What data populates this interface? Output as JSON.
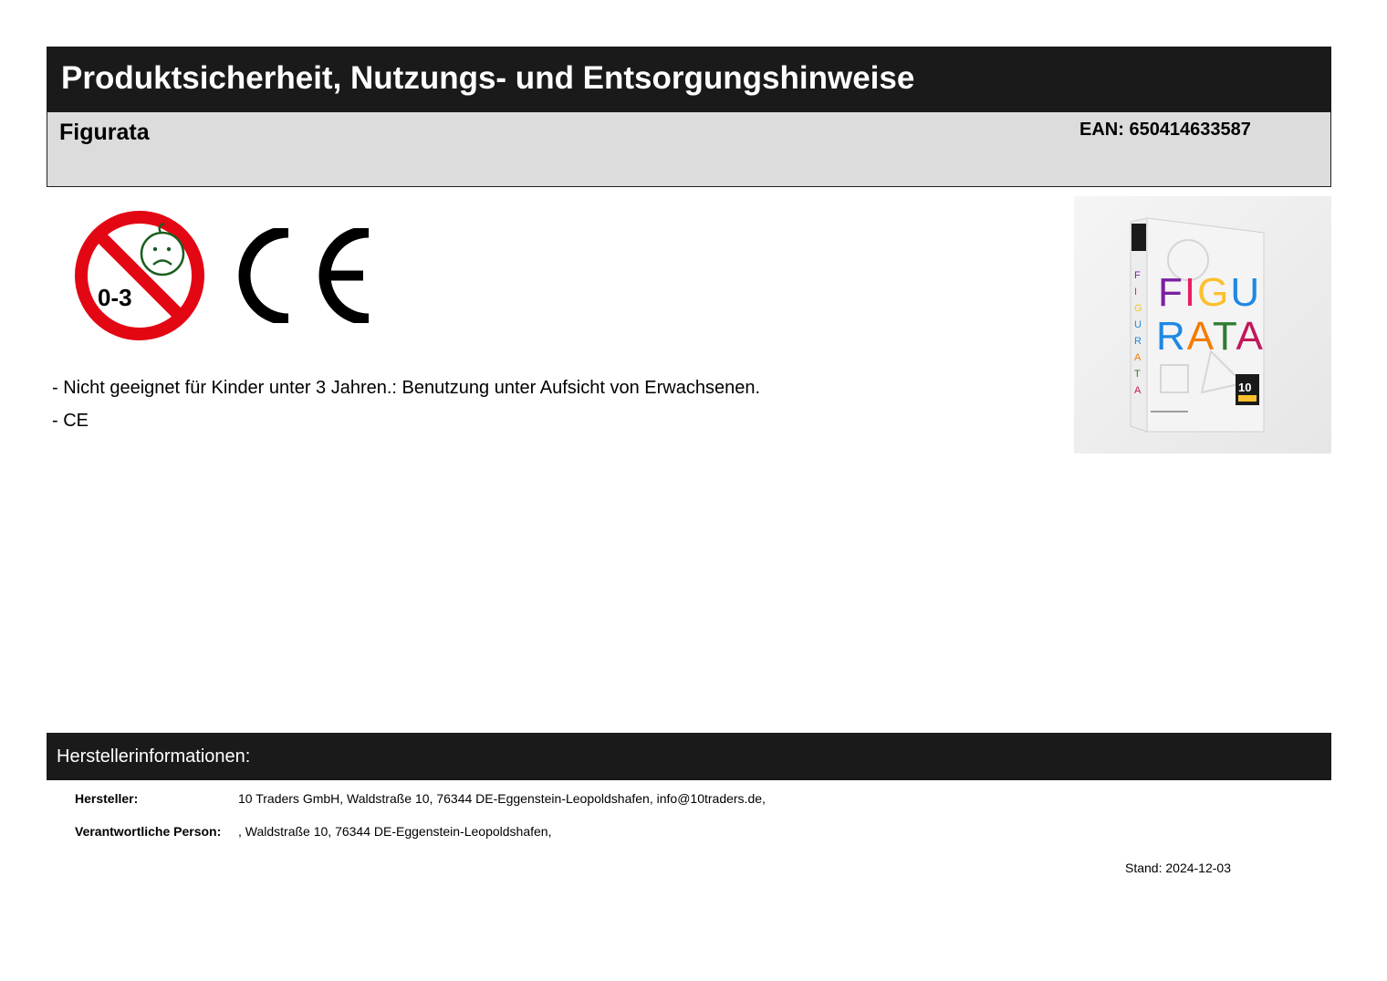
{
  "header": {
    "title": "Produktsicherheit, Nutzungs- und Entsorgungshinweise"
  },
  "product": {
    "name": "Figurata",
    "ean": "EAN: 650414633587"
  },
  "icons": {
    "under3_label": "0-3",
    "under3_icon": "not-for-children-under-3-icon",
    "ce_icon": "ce-mark-icon"
  },
  "product_image": {
    "box_title_line1": "FIGU",
    "box_title_line2": "RATA",
    "spine_text": "FIGURATA",
    "badge_text": "10"
  },
  "notes": [
    "- Nicht geeignet für Kinder unter 3 Jahren.: Benutzung unter Aufsicht von Erwachsenen.",
    "- CE"
  ],
  "manufacturer": {
    "heading": "Herstellerinformationen:",
    "maker_label": "Hersteller:",
    "maker_value": "10 Traders GmbH, Waldstraße 10, 76344 DE-Eggenstein-Leopoldshafen, info@10traders.de,",
    "person_label": "Verantwortliche Person:",
    "person_value": ", Waldstraße 10, 76344 DE-Eggenstein-Leopoldshafen,"
  },
  "stand": "Stand: 2024-12-03",
  "colors": {
    "header_bg": "#1a1a1a",
    "product_bar_bg": "#dcdcdc",
    "prohibition_red": "#e30613",
    "face_green": "#1b5e20"
  }
}
